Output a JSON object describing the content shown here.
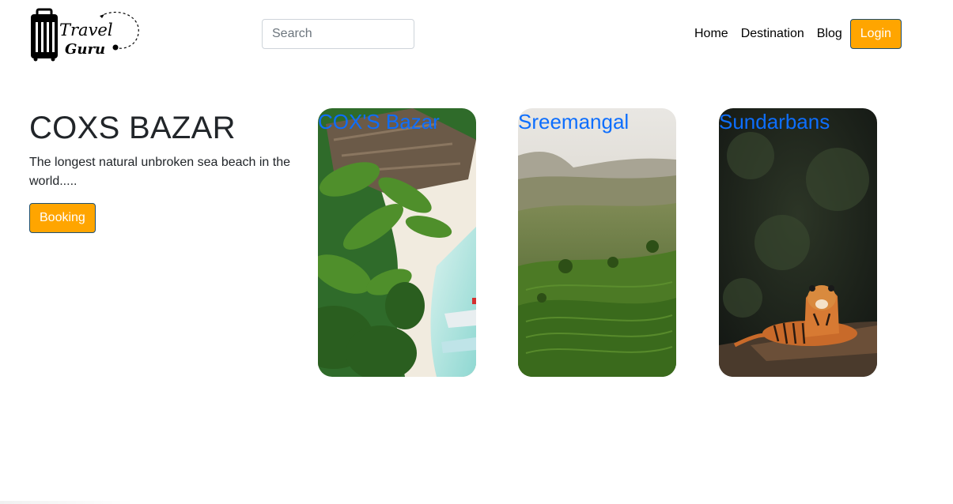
{
  "header": {
    "logo_line1": "Travel",
    "logo_line2": "Guru",
    "search_placeholder": "Search",
    "nav": [
      {
        "label": "Home"
      },
      {
        "label": "Destination"
      },
      {
        "label": "Blog"
      }
    ],
    "login_label": "Login"
  },
  "hero": {
    "title": "COXS BAZAR",
    "description": "The longest natural unbroken sea beach in the world.....",
    "booking_label": "Booking"
  },
  "cards": [
    {
      "title": "COX'S Bazar"
    },
    {
      "title": "Sreemangal"
    },
    {
      "title": "Sundarbans"
    }
  ],
  "colors": {
    "accent": "#ffa500",
    "button_border": "#1d4f73",
    "link_blue": "#0d6efd"
  }
}
